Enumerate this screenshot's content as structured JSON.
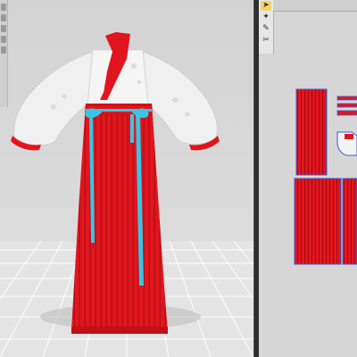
{
  "colors": {
    "skirt_red": "#e0151d",
    "sash_blue": "#37c6e4",
    "shirt_white": "#f2f2f2",
    "pattern_outline": "#3b5bd8",
    "viewport_bg": "#d6d6d6"
  },
  "left_toolbar": {
    "tools": [
      "select-icon",
      "move-icon",
      "rotate-icon",
      "pin-icon",
      "zoom-icon"
    ]
  },
  "pattern_toolbar": {
    "tools": [
      {
        "name": "select-tool-icon",
        "glyph": "➤"
      },
      {
        "name": "transform-tool-icon",
        "glyph": "✦"
      },
      {
        "name": "edit-tool-icon",
        "glyph": "✎"
      },
      {
        "name": "sew-tool-icon",
        "glyph": "✂"
      }
    ]
  }
}
